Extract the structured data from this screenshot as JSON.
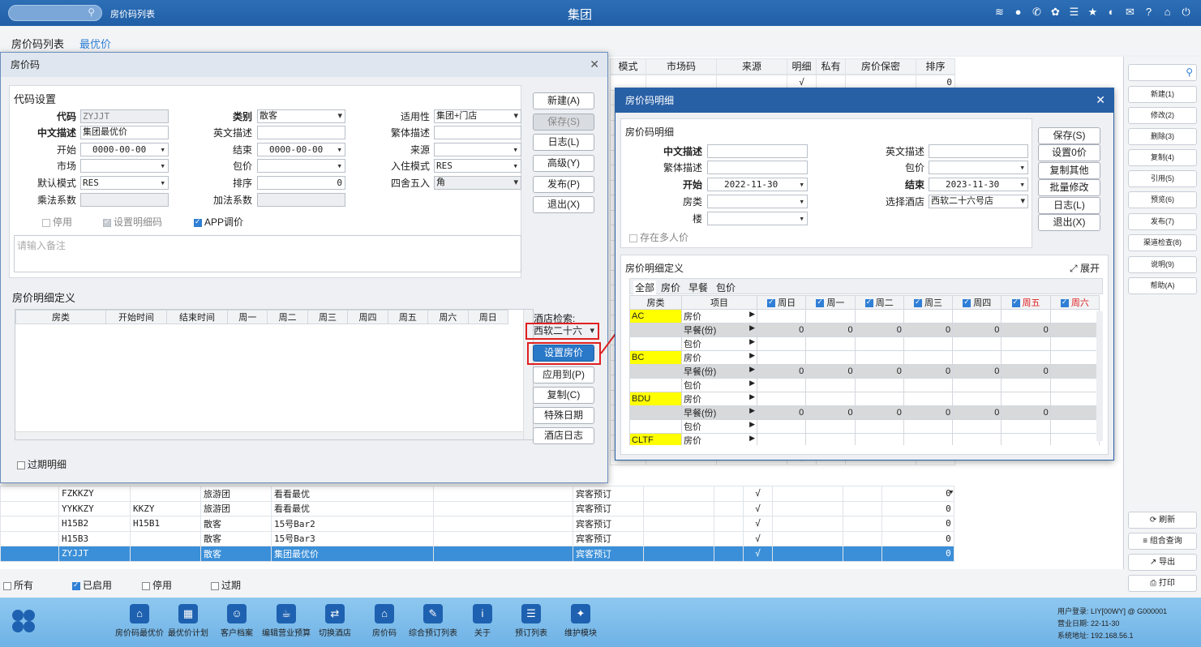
{
  "topbar": {
    "tab_title": "房价码列表",
    "title": "集团",
    "icons": [
      "wifi-icon",
      "message-icon",
      "phone-icon",
      "palette-icon",
      "menu-icon",
      "star-icon",
      "moon-icon",
      "mail-icon",
      "help-icon",
      "home-icon",
      "power-icon"
    ]
  },
  "tabs": {
    "list": "房价码列表",
    "best": "最优价"
  },
  "grid": {
    "headers": [
      "模式",
      "市场码",
      "来源",
      "明细",
      "私有",
      "房价保密",
      "排序"
    ],
    "rows": [
      {
        "code": "FZKKZY",
        "sub": "",
        "type": "旅游团",
        "desc": "看看最优",
        "mode": "宾客预订",
        "detail": "√",
        "sort": "0"
      },
      {
        "code": "YYKKZY",
        "sub": "KKZY",
        "type": "旅游团",
        "desc": "看看最优",
        "mode": "宾客预订",
        "detail": "√",
        "sort": "0"
      },
      {
        "code": "H15B2",
        "sub": "H15B1",
        "type": "散客",
        "desc": "15号Bar2",
        "mode": "宾客预订",
        "detail": "√",
        "sort": "0"
      },
      {
        "code": "H15B3",
        "sub": "",
        "type": "散客",
        "desc": "15号Bar3",
        "mode": "宾客预订",
        "detail": "√",
        "sort": "0"
      },
      {
        "code": "ZYJJT",
        "sub": "",
        "type": "散客",
        "desc": "集团最优价",
        "mode": "宾客预订",
        "detail": "√",
        "sort": "0"
      }
    ],
    "bg_detail": "√",
    "bg_sort": "0"
  },
  "right_buttons": [
    "新建(1)",
    "修改(2)",
    "删除(3)",
    "复制(4)",
    "引用(5)",
    "预览(6)",
    "发布(7)",
    "渠道检查(8)",
    "说明(9)",
    "帮助(A)"
  ],
  "right_buttons2": [
    "刷新",
    "组合查询",
    "导出",
    "打印"
  ],
  "filters": {
    "all": "所有",
    "enabled": "已启用",
    "disabled": "停用",
    "expired": "过期"
  },
  "bottom": {
    "items": [
      "房价码最优价",
      "最优价计划",
      "客户档案",
      "编辑营业预算",
      "切换酒店",
      "房价码",
      "综合预订列表",
      "关于",
      "预订列表",
      "维护模块"
    ],
    "login": "用户登录: LIY[00WY] @ G000001",
    "date": "营业日期: 22-11-30",
    "addr": "系统地址: 192.168.56.1"
  },
  "dlg1": {
    "title": "房价码",
    "sec1": "代码设置",
    "labels": {
      "code": "代码",
      "cname": "中文描述",
      "start": "开始",
      "market": "市场",
      "defmode": "默认模式",
      "mulcoef": "乘法系数",
      "cat": "类别",
      "ename": "英文描述",
      "end": "结束",
      "pkg": "包价",
      "sort": "排序",
      "addcoef": "加法系数",
      "applic": "适用性",
      "trad": "繁体描述",
      "source": "来源",
      "checkin": "入住模式",
      "round": "四舍五入"
    },
    "values": {
      "code": "ZYJJT",
      "cname": "集团最优价",
      "start": "0000-00-00",
      "market": "",
      "defmode": "RES",
      "mulcoef": "",
      "cat": "散客",
      "ename": "",
      "end": "0000-00-00",
      "pkg": "",
      "sort": "0",
      "addcoef": "",
      "applic": "集团+门店",
      "trad": "",
      "source": "",
      "checkin": "RES",
      "round": "角"
    },
    "checks": {
      "stop": "停用",
      "setdetail": "设置明细码",
      "app": "APP调价"
    },
    "remark_placeholder": "请输入备注",
    "buttons": [
      "新建(A)",
      "保存(S)",
      "日志(L)",
      "高级(Y)",
      "发布(P)",
      "退出(X)"
    ],
    "sec2": "房价明细定义",
    "detail_headers": [
      "房类",
      "开始时间",
      "结束时间",
      "周一",
      "周二",
      "周三",
      "周四",
      "周五",
      "周六",
      "周日"
    ],
    "hotel_search": "酒店检索:",
    "hotel_value": "西软二十六",
    "buttons2": [
      "设置房价",
      "应用到(P)",
      "复制(C)",
      "特殊日期",
      "酒店日志"
    ],
    "expired": "过期明细"
  },
  "dlg2": {
    "title": "房价码明细",
    "sec1": "房价码明细",
    "labels": {
      "cname": "中文描述",
      "trad": "繁体描述",
      "start": "开始",
      "rtype": "房类",
      "floor": "楼",
      "ename": "英文描述",
      "pkg": "包价",
      "end": "结束",
      "hotel": "选择酒店"
    },
    "values": {
      "start": "2022-11-30",
      "end": "2023-11-30",
      "hotel": "西软二十六号店"
    },
    "multi": "存在多人价",
    "buttons": [
      "保存(S)",
      "设置0价",
      "复制其他",
      "批量修改",
      "日志(L)",
      "退出(X)"
    ],
    "sec2": "房价明细定义",
    "expand": "展开",
    "subtabs": [
      "全部",
      "房价",
      "早餐",
      "包价"
    ],
    "headers": [
      "房类",
      "项目",
      "周日",
      "周一",
      "周二",
      "周三",
      "周四",
      "周五",
      "周六"
    ],
    "rooms": [
      "AC",
      "BC",
      "BDU",
      "CLTF"
    ],
    "items": [
      "房价",
      "早餐(份)",
      "包价"
    ],
    "zero": "0"
  }
}
